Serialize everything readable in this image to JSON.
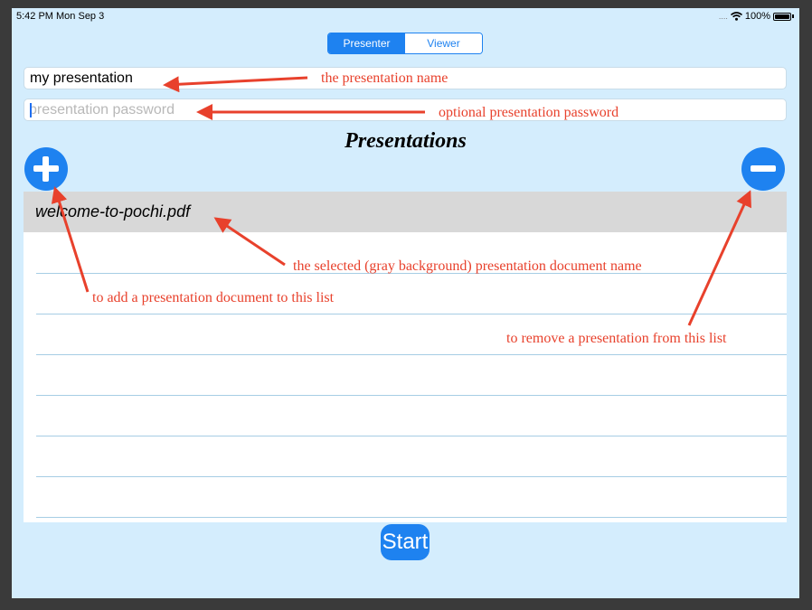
{
  "status_bar": {
    "time": "5:42 PM  Mon Sep 3",
    "signal": "....",
    "battery": "100%"
  },
  "segmented_control": {
    "options": [
      "Presenter",
      "Viewer"
    ],
    "selected": "Presenter"
  },
  "name_field": {
    "value": "my presentation"
  },
  "password_field": {
    "placeholder": "presentation password"
  },
  "presentations": {
    "title": "Presentations",
    "items": [
      "welcome-to-pochi.pdf"
    ],
    "selected_index": 0
  },
  "start_button": {
    "label": "Start"
  },
  "annotations": {
    "name": "the presentation name",
    "password": "optional presentation password",
    "selected": "the selected (gray background) presentation document name",
    "add": "to add a presentation document to this list",
    "remove": "to remove a presentation from this list"
  },
  "colors": {
    "accent": "#1e82f0",
    "background": "#d4edfd",
    "annotation": "#e8412c",
    "selected_row": "#d8d8d8"
  },
  "icons": {
    "add": "plus-circle-icon",
    "remove": "minus-circle-icon",
    "wifi": "wifi-icon",
    "battery": "battery-icon"
  }
}
